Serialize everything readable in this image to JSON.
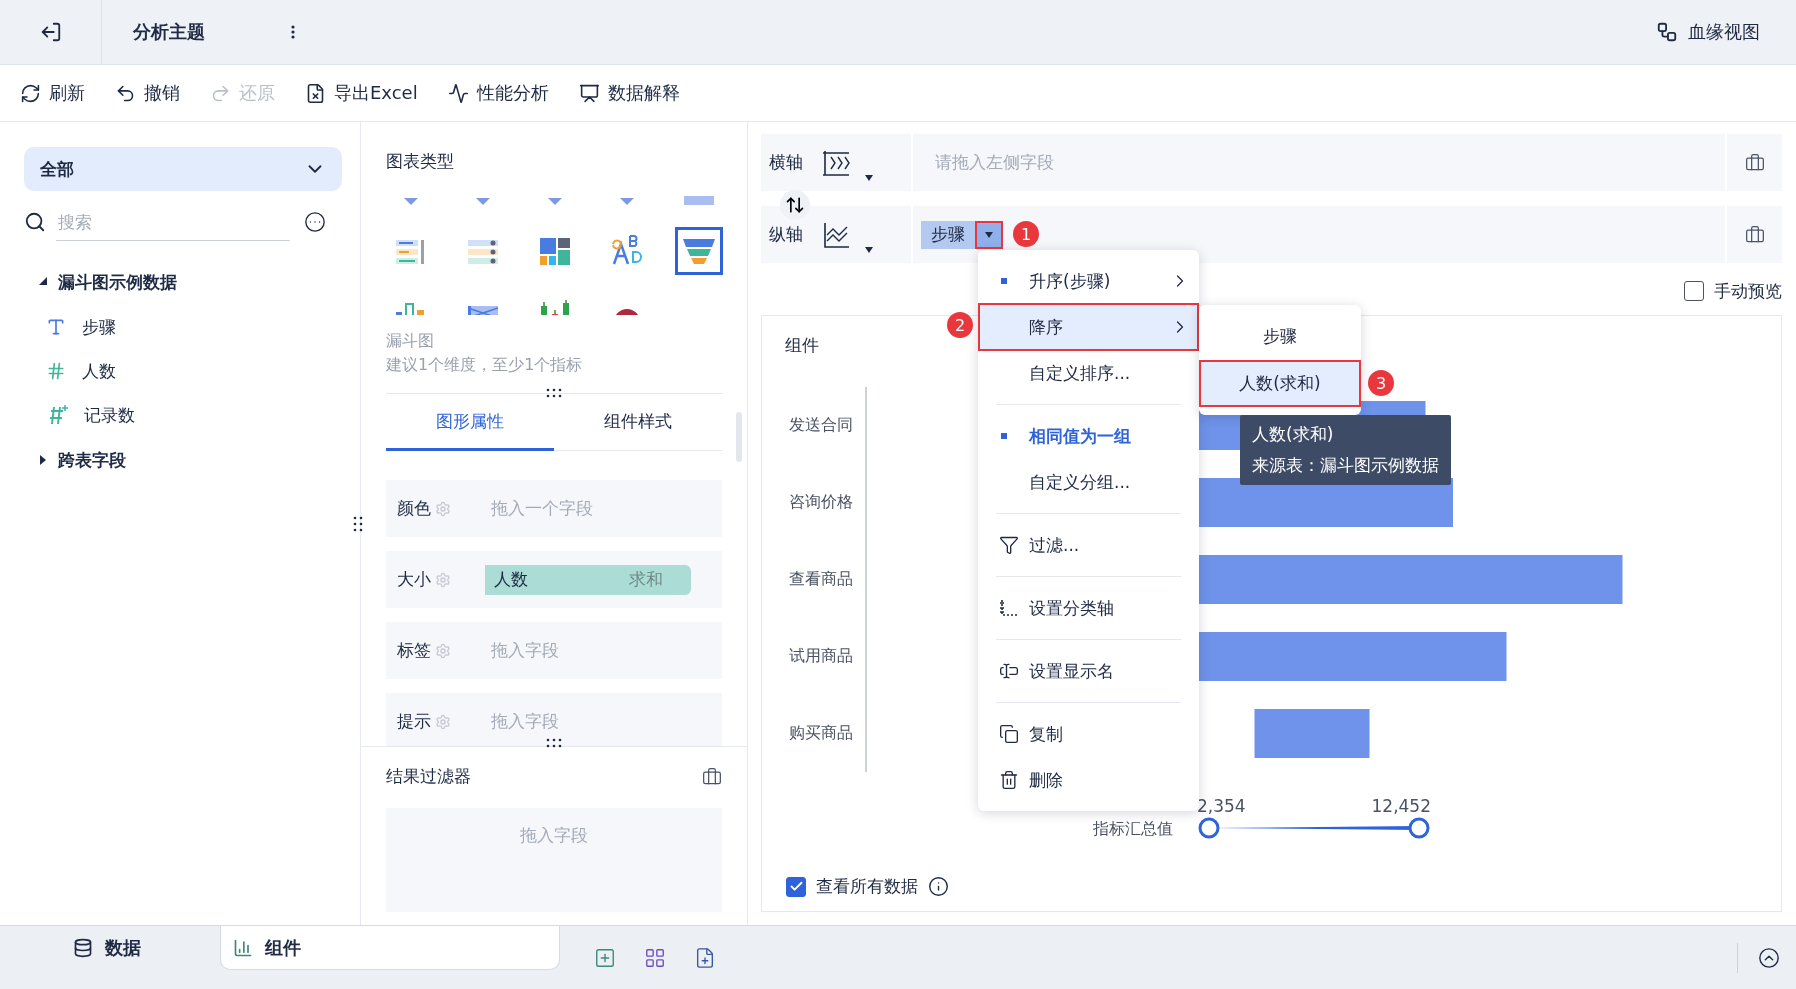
{
  "topbar": {
    "title": "分析主题",
    "lineage_label": "血缘视图"
  },
  "toolbar": [
    {
      "label": "刷新",
      "kind": "refresh",
      "disabled": false
    },
    {
      "label": "撤销",
      "kind": "undo",
      "disabled": false
    },
    {
      "label": "还原",
      "kind": "redo",
      "disabled": true
    },
    {
      "label": "导出Excel",
      "kind": "excel",
      "disabled": false
    },
    {
      "label": "性能分析",
      "kind": "performance",
      "disabled": false
    },
    {
      "label": "数据解释",
      "kind": "explain",
      "disabled": false
    }
  ],
  "data_panel": {
    "scope": "全部",
    "search": {
      "placeholder": "搜索"
    },
    "tree": [
      {
        "label": "漏斗图示例数据",
        "expanded": true,
        "children": [
          {
            "label": "步骤",
            "kind": "text"
          },
          {
            "label": "人数",
            "kind": "number"
          },
          {
            "label": "记录数",
            "kind": "count"
          }
        ]
      },
      {
        "label": "跨表字段",
        "expanded": false
      }
    ]
  },
  "chart_panel": {
    "title": "图表类型",
    "chart_types": [
      {
        "kind": "pin",
        "selected": false
      },
      {
        "kind": "pin",
        "selected": false
      },
      {
        "kind": "pin",
        "selected": false
      },
      {
        "kind": "pin",
        "selected": false
      },
      {
        "kind": "band",
        "selected": false
      },
      {
        "kind": "ranked-list",
        "selected": false
      },
      {
        "kind": "list",
        "selected": false
      },
      {
        "kind": "treemap",
        "selected": false
      },
      {
        "kind": "word-cloud",
        "selected": false
      },
      {
        "kind": "funnel",
        "selected": true
      },
      {
        "kind": "bar-mix",
        "selected": false
      },
      {
        "kind": "range",
        "selected": false
      },
      {
        "kind": "candlestick",
        "selected": false
      },
      {
        "kind": "ring",
        "selected": false
      }
    ],
    "selected_name": "漏斗图",
    "hint": "建议1个维度，至少1个指标",
    "tabs": [
      {
        "label": "图形属性",
        "selected": true
      },
      {
        "label": "组件样式",
        "selected": false
      }
    ],
    "properties": [
      {
        "label": "颜色",
        "kind": "empty",
        "placeholder": "拖入一个字段"
      },
      {
        "label": "大小",
        "kind": "field",
        "field": "人数",
        "aggregation": "求和"
      },
      {
        "label": "标签",
        "kind": "empty",
        "placeholder": "拖入字段"
      },
      {
        "label": "提示",
        "kind": "empty",
        "placeholder": "拖入字段"
      }
    ],
    "result_filter": {
      "title": "结果过滤器",
      "placeholder": "拖入字段"
    }
  },
  "axes": [
    {
      "label": "横轴",
      "kind": "x",
      "placeholder": "请拖入左侧字段"
    },
    {
      "label": "纵轴",
      "kind": "y",
      "field": "步骤",
      "arrow_outlined": true
    }
  ],
  "manual_preview": {
    "label": "手动预览",
    "checked": false
  },
  "widget": {
    "title": "组件",
    "categories": [
      "发送合同",
      "咨询价格",
      "查看商品",
      "试用商品",
      "购买商品"
    ],
    "legend": {
      "label": "指标汇总值",
      "min": "2,354",
      "max": "12,452",
      "handles": [
        {
          "level": 0
        },
        {
          "level": 1
        }
      ]
    },
    "view_all": {
      "label": "查看所有数据",
      "checked": true
    }
  },
  "field_menu": {
    "groups": [
      [
        {
          "label": "升序(步骤)",
          "kind": "plain",
          "checked": true,
          "emphasized": false,
          "submenu": true,
          "selected": false,
          "outlined": false
        },
        {
          "label": "降序",
          "kind": "plain",
          "checked": false,
          "emphasized": false,
          "submenu": true,
          "selected": true,
          "outlined": true
        },
        {
          "label": "自定义排序...",
          "kind": "plain",
          "checked": false,
          "emphasized": false,
          "submenu": false,
          "selected": false,
          "outlined": false
        }
      ],
      [
        {
          "label": "相同值为一组",
          "kind": "plain",
          "checked": true,
          "emphasized": true,
          "submenu": false,
          "selected": false,
          "outlined": false
        },
        {
          "label": "自定义分组...",
          "kind": "plain",
          "checked": false,
          "emphasized": false,
          "submenu": false,
          "selected": false,
          "outlined": false
        }
      ],
      [
        {
          "label": "过滤...",
          "kind": "filter",
          "checked": false,
          "emphasized": false,
          "submenu": false,
          "selected": false,
          "outlined": false
        }
      ],
      [
        {
          "label": "设置分类轴",
          "kind": "axis",
          "checked": false,
          "emphasized": false,
          "submenu": false,
          "selected": false,
          "outlined": false
        }
      ],
      [
        {
          "label": "设置显示名",
          "kind": "rename",
          "checked": false,
          "emphasized": false,
          "submenu": false,
          "selected": false,
          "outlined": false
        }
      ],
      [
        {
          "label": "复制",
          "kind": "copy",
          "checked": false,
          "emphasized": false,
          "submenu": false,
          "selected": false,
          "outlined": false
        },
        {
          "label": "删除",
          "kind": "delete",
          "checked": false,
          "emphasized": false,
          "submenu": false,
          "selected": false,
          "outlined": false
        }
      ]
    ]
  },
  "submenu": {
    "items": [
      {
        "label": "步骤",
        "selected": false,
        "outlined": false
      },
      {
        "label": "人数(求和)",
        "selected": true,
        "outlined": true
      }
    ]
  },
  "tooltip": {
    "lines": [
      "人数(求和)",
      "来源表：漏斗图示例数据"
    ]
  },
  "callouts": [
    "1",
    "2",
    "3"
  ],
  "bottom_tabs": [
    {
      "label": "数据",
      "kind": "data",
      "selected": false
    },
    {
      "label": "组件",
      "kind": "widget",
      "selected": true
    }
  ]
}
